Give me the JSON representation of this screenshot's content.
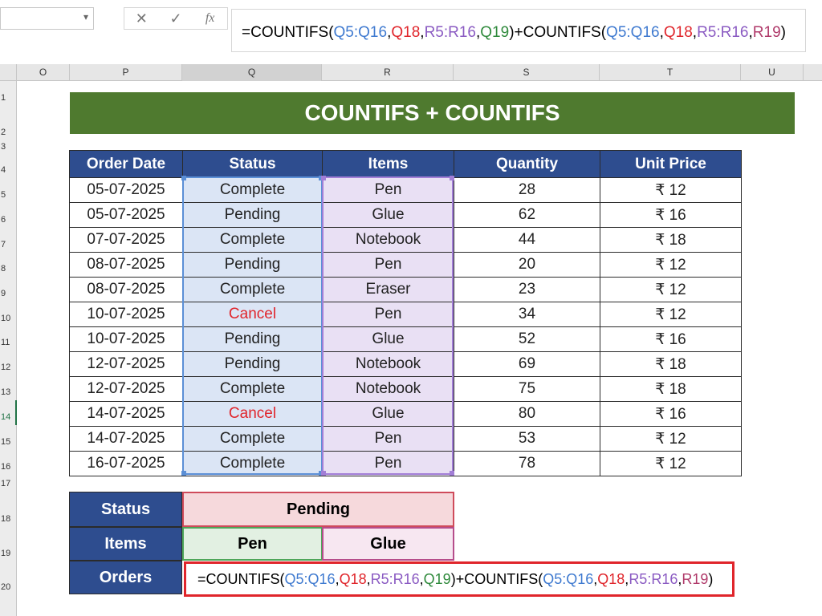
{
  "formula_bar": {
    "fx_cancel": "✕",
    "fx_enter": "✓",
    "fx_label": "fx",
    "tokens": [
      {
        "text": "=COUNTIFS(",
        "color": "#000000"
      },
      {
        "text": "Q5:Q16",
        "color": "#3f7ad0"
      },
      {
        "text": ",",
        "color": "#000000"
      },
      {
        "text": "Q18",
        "color": "#e0252b"
      },
      {
        "text": ",",
        "color": "#000000"
      },
      {
        "text": "R5:R16",
        "color": "#8a5ac2"
      },
      {
        "text": ",",
        "color": "#000000"
      },
      {
        "text": "Q19",
        "color": "#2f8a3c"
      },
      {
        "text": ")+COUNTIFS(",
        "color": "#000000"
      },
      {
        "text": "Q5:Q16",
        "color": "#3f7ad0"
      },
      {
        "text": ",",
        "color": "#000000"
      },
      {
        "text": "Q18",
        "color": "#e0252b"
      },
      {
        "text": ",",
        "color": "#000000"
      },
      {
        "text": "R5:R16",
        "color": "#8a5ac2"
      },
      {
        "text": ",",
        "color": "#000000"
      },
      {
        "text": "R19",
        "color": "#b03a6a"
      },
      {
        "text": ")",
        "color": "#000000"
      }
    ]
  },
  "columns": [
    "O",
    "P",
    "Q",
    "R",
    "S",
    "T",
    "U"
  ],
  "rows": [
    "1",
    "2",
    "3",
    "4",
    "5",
    "6",
    "7",
    "8",
    "9",
    "10",
    "11",
    "12",
    "13",
    "14",
    "15",
    "16",
    "17",
    "18",
    "19",
    "20"
  ],
  "banner": "COUNTIFS + COUNTIFS",
  "table": {
    "headers": [
      "Order Date",
      "Status",
      "Items",
      "Quantity",
      "Unit Price"
    ],
    "rows": [
      [
        "05-07-2025",
        "Complete",
        "Pen",
        "28",
        "₹ 12"
      ],
      [
        "05-07-2025",
        "Pending",
        "Glue",
        "62",
        "₹ 16"
      ],
      [
        "07-07-2025",
        "Complete",
        "Notebook",
        "44",
        "₹ 18"
      ],
      [
        "08-07-2025",
        "Pending",
        "Pen",
        "20",
        "₹ 12"
      ],
      [
        "08-07-2025",
        "Complete",
        "Eraser",
        "23",
        "₹ 12"
      ],
      [
        "10-07-2025",
        "Cancel",
        "Pen",
        "34",
        "₹ 12"
      ],
      [
        "10-07-2025",
        "Pending",
        "Glue",
        "52",
        "₹ 16"
      ],
      [
        "12-07-2025",
        "Pending",
        "Notebook",
        "69",
        "₹ 18"
      ],
      [
        "12-07-2025",
        "Complete",
        "Notebook",
        "75",
        "₹ 18"
      ],
      [
        "14-07-2025",
        "Cancel",
        "Glue",
        "80",
        "₹ 16"
      ],
      [
        "14-07-2025",
        "Complete",
        "Pen",
        "53",
        "₹ 12"
      ],
      [
        "16-07-2025",
        "Complete",
        "Pen",
        "78",
        "₹ 12"
      ]
    ]
  },
  "criteria": {
    "status_label": "Status",
    "status_value": "Pending",
    "items_label": "Items",
    "item_1": "Pen",
    "item_2": "Glue",
    "orders_label": "Orders"
  },
  "colors": {
    "banner_bg": "#4f7a2f",
    "header_bg": "#2e4d8f",
    "cancel_text": "#e0252b",
    "active_cell_border": "#e0252b"
  }
}
